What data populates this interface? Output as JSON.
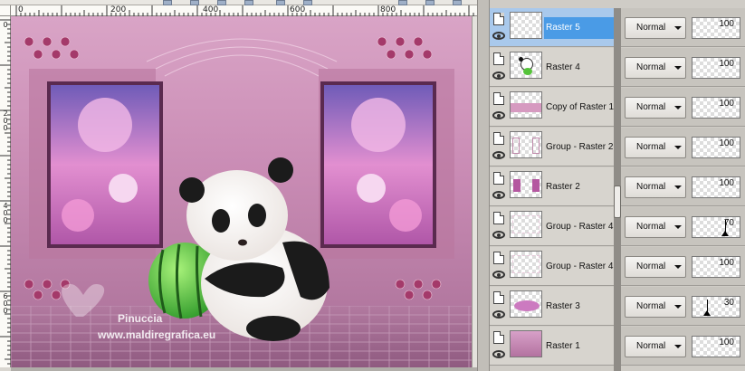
{
  "canvas": {
    "ruler_top_labels": [
      "0",
      "200",
      "400",
      "600",
      "800"
    ],
    "ruler_left_labels": [
      "0",
      "200",
      "400",
      "600"
    ],
    "watermark": {
      "line1": "Pinuccia",
      "line2": "www.maldiregrafica.eu"
    }
  },
  "layers": [
    {
      "name": "Raster 5",
      "blend_mode": "Normal",
      "opacity": "100",
      "selected": true,
      "thumb": "empty"
    },
    {
      "name": "Raster 4",
      "blend_mode": "Normal",
      "opacity": "100",
      "selected": false,
      "thumb": "panda"
    },
    {
      "name": "Copy of Raster 1",
      "blend_mode": "Normal",
      "opacity": "100",
      "selected": false,
      "thumb": "pink-band"
    },
    {
      "name": "Group - Raster 2",
      "blend_mode": "Normal",
      "opacity": "100",
      "selected": false,
      "thumb": "frames-outline"
    },
    {
      "name": "Raster 2",
      "blend_mode": "Normal",
      "opacity": "100",
      "selected": false,
      "thumb": "frames"
    },
    {
      "name": "Group - Raster 4",
      "blend_mode": "Normal",
      "opacity": "70",
      "opacity_fraction": 0.7,
      "selected": false,
      "thumb": "faint"
    },
    {
      "name": "Group - Raster 4",
      "blend_mode": "Normal",
      "opacity": "100",
      "selected": false,
      "thumb": "faint"
    },
    {
      "name": "Raster 3",
      "blend_mode": "Normal",
      "opacity": "30",
      "opacity_fraction": 0.3,
      "selected": false,
      "thumb": "pink-oval"
    },
    {
      "name": "Raster 1",
      "blend_mode": "Normal",
      "opacity": "100",
      "selected": false,
      "thumb": "pink-fill"
    }
  ],
  "colors": {
    "selected_row": "#4a9be6",
    "canvas_pink": "#c98fb4",
    "panel_bg": "#cfccc6"
  },
  "icons": {
    "visibility": "eye-icon",
    "layer_type": "page-icon",
    "dropdown": "chevron-down-icon"
  }
}
